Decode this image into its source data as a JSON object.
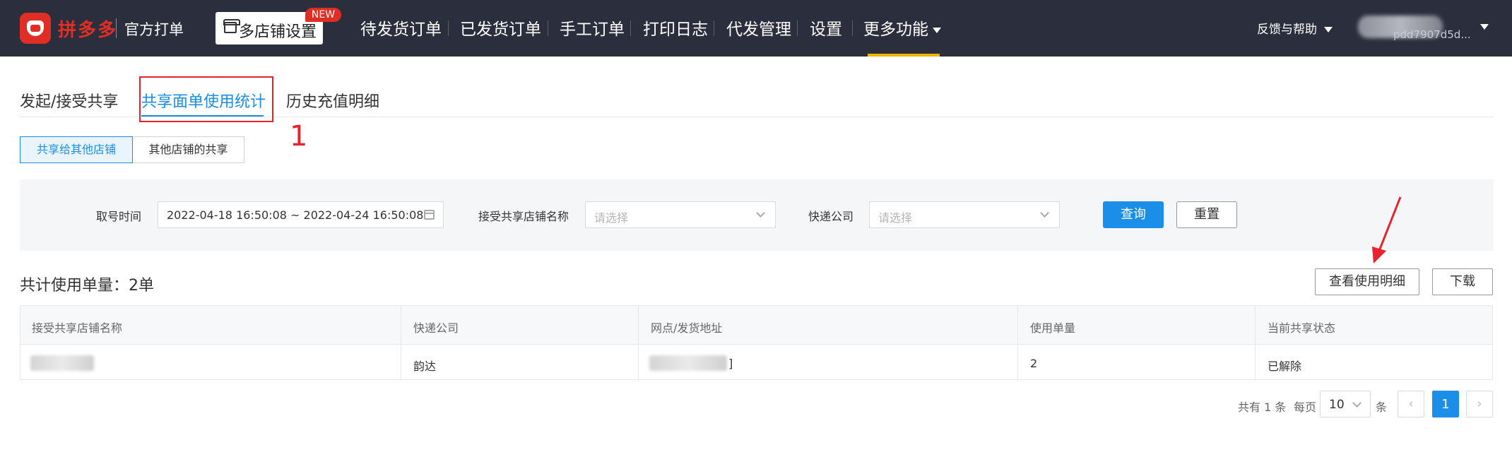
{
  "topbar": {
    "brand": "拼多多",
    "brand_sub": "官方打单",
    "shop_button": "多店铺设置",
    "new_badge": "NEW",
    "nav": [
      "待发货订单",
      "已发货订单",
      "手工订单",
      "打印日志",
      "代发管理",
      "设置"
    ],
    "more": "更多功能",
    "help": "反馈与帮助",
    "user_name": "pdd7907d5d..."
  },
  "tabs": {
    "items": [
      "发起/接受共享",
      "共享面单使用统计",
      "历史充值明细"
    ],
    "active_index": 1,
    "annotation_number": "1"
  },
  "segments": {
    "active": "共享给其他店铺",
    "other": "其他店铺的共享"
  },
  "filter": {
    "time_label": "取号时间",
    "time_value": "2022-04-18 16:50:08 ~ 2022-04-24 16:50:08",
    "shop_label": "接受共享店铺名称",
    "shop_placeholder": "请选择",
    "express_label": "快递公司",
    "express_placeholder": "请选择",
    "query": "查询",
    "reset": "重置"
  },
  "summary": {
    "total": "共计使用单量：2单",
    "detail_button": "查看使用明细",
    "download_button": "下载"
  },
  "table": {
    "headers": [
      "接受共享店铺名称",
      "快递公司",
      "网点/发货地址",
      "使用单量",
      "当前共享状态"
    ],
    "row": {
      "express": "韵达",
      "address_suffix": "]",
      "count": "2",
      "status": "已解除"
    }
  },
  "pagination": {
    "total_text": "共有 1 条",
    "per_page_label": "每页",
    "per_page_value": "10",
    "unit": "条",
    "prev": "‹",
    "current": "1",
    "next": "›"
  },
  "colors": {
    "accent": "#1a8ee8",
    "brand_red": "#e02e24",
    "annotation_red": "#e8232d",
    "topbar_bg": "#2b2e3d"
  }
}
